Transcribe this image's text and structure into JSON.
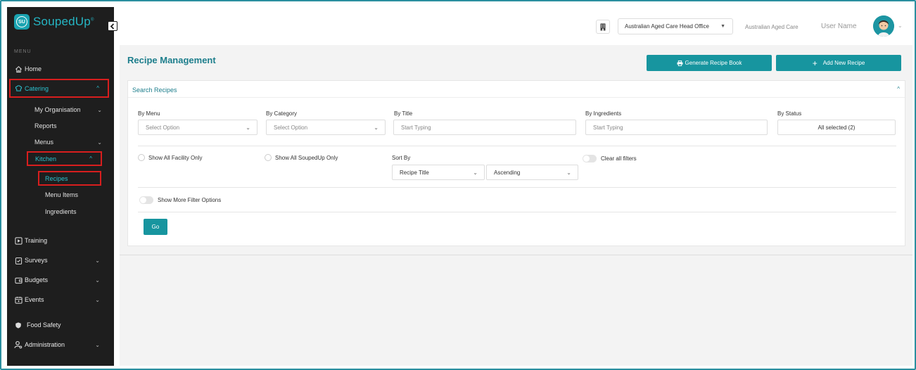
{
  "brand": {
    "logo_initials": "SU",
    "logo_text": "SoupedUp",
    "trademark": "®"
  },
  "sidebar": {
    "menu_label": "MENU",
    "items": {
      "home": "Home",
      "catering": "Catering",
      "my_organisation": "My Organisation",
      "reports": "Reports",
      "menus": "Menus",
      "kitchen": "Kitchen",
      "recipes": "Recipes",
      "menu_items": "Menu Items",
      "ingredients": "Ingredients",
      "training": "Training",
      "surveys": "Surveys",
      "budgets": "Budgets",
      "events": "Events",
      "food_safety": "Food Safety",
      "administration": "Administration"
    }
  },
  "header": {
    "office_selected": "Australian Aged Care Head Office",
    "org_name": "Australian Aged Care",
    "user_name": "User Name"
  },
  "page": {
    "title": "Recipe Management",
    "generate_btn": "Generate Recipe Book",
    "add_btn": "Add New Recipe"
  },
  "search": {
    "title": "Search Recipes",
    "by_menu_label": "By Menu",
    "by_menu_value": "Select Option",
    "by_category_label": "By Category",
    "by_category_value": "Select Option",
    "by_title_label": "By Title",
    "by_title_placeholder": "Start Typing",
    "by_ingredients_label": "By Ingredients",
    "by_ingredients_placeholder": "Start Typing",
    "by_status_label": "By Status",
    "by_status_value": "All selected (2)",
    "show_facility_only": "Show All Facility Only",
    "show_soupedup_only": "Show All SoupedUp Only",
    "sort_by_label": "Sort By",
    "sort_field_value": "Recipe Title",
    "sort_order_value": "Ascending",
    "clear_filters": "Clear all filters",
    "more_filters": "Show More Filter Options",
    "go_btn": "Go"
  },
  "colors": {
    "accent": "#17959f",
    "sidebar_bg": "#1e1e1e",
    "highlight": "#d81e1e"
  }
}
